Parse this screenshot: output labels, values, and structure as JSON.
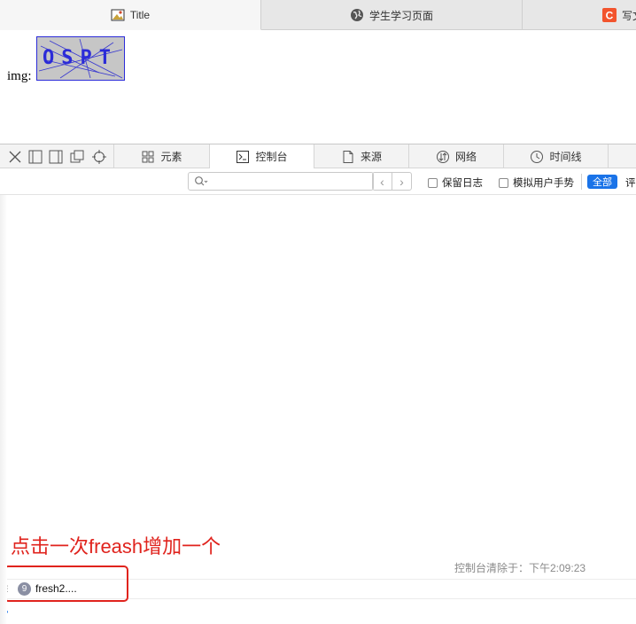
{
  "browser": {
    "tabs": [
      {
        "label": "Title",
        "icon": "image-icon",
        "active": true
      },
      {
        "label": "学生学习页面",
        "icon": "globe-icon",
        "active": false
      },
      {
        "label": "写文",
        "icon": "csdn-c-icon",
        "active": false
      }
    ]
  },
  "page": {
    "label": "img:",
    "captcha": {
      "text": "OSPT",
      "colors": {
        "background": "#c6c6c6",
        "text": "#2b2bd8"
      }
    }
  },
  "devtools": {
    "tabs": [
      {
        "label": "元素",
        "icon": "elements-icon"
      },
      {
        "label": "控制台",
        "icon": "console-icon",
        "active": true
      },
      {
        "label": "来源",
        "icon": "sources-icon"
      },
      {
        "label": "网络",
        "icon": "network-icon"
      },
      {
        "label": "时间线",
        "icon": "timeline-icon"
      }
    ],
    "filter": {
      "search_placeholder": "",
      "preserve_log": "保留日志",
      "simulate_gesture": "模拟用户手势",
      "all_label": "全部",
      "more_label": "评"
    },
    "console": {
      "annotation": "点击一次freash增加一个",
      "cleared_text": "控制台清除于：下午2:09:23",
      "log": {
        "count": "9",
        "text": "fresh2...."
      },
      "accent": "#1a73e8"
    }
  }
}
